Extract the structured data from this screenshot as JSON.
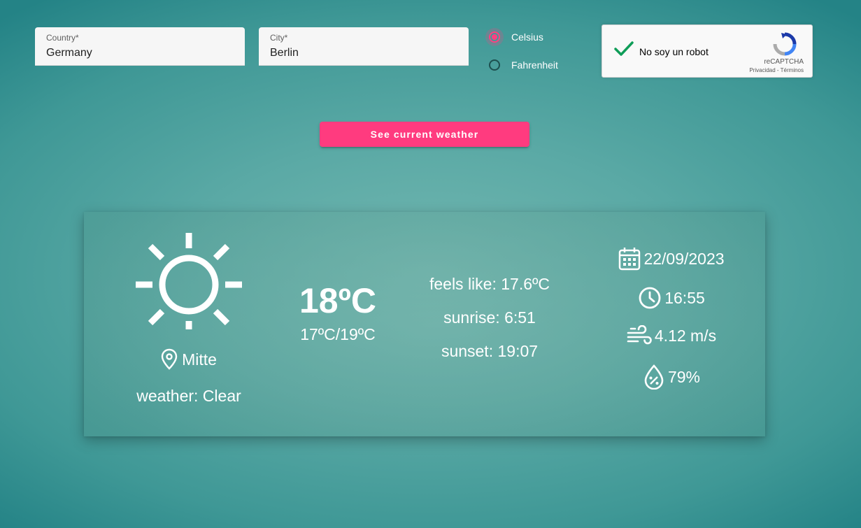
{
  "form": {
    "country": {
      "label": "Country*",
      "value": "Germany"
    },
    "city": {
      "label": "City*",
      "value": "Berlin"
    },
    "units": [
      {
        "label": "Celsius",
        "checked": true
      },
      {
        "label": "Fahrenheit",
        "checked": false
      }
    ],
    "recaptcha": {
      "label": "No soy un robot",
      "brand": "reCAPTCHA",
      "links": "Privacidad - Términos",
      "checked": true
    },
    "submit_label": "See current weather"
  },
  "weather": {
    "icon": "sun-icon",
    "location": "Mitte",
    "condition": "weather: Clear",
    "temperature": "18ºC",
    "range": "17ºC/19ºC",
    "feels_like": "feels like: 17.6ºC",
    "sunrise": "sunrise: 6:51",
    "sunset": "sunset: 19:07",
    "date": "22/09/2023",
    "time": "16:55",
    "wind": "4.12 m/s",
    "humidity": "79%"
  },
  "colors": {
    "accent": "#ff3b7f",
    "background": "#5aa9a5",
    "checkmark": "#0f9d58"
  }
}
